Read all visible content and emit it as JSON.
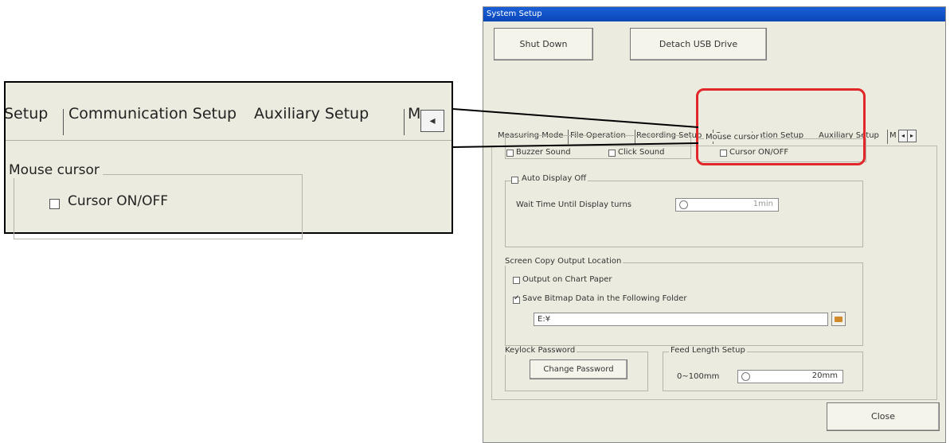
{
  "window": {
    "title": "System Setup"
  },
  "top_buttons": {
    "shutdown": "Shut Down",
    "detach": "Detach USB Drive"
  },
  "tabs": [
    "Measuring Mode",
    "File Operation",
    "Recording Setup",
    "Communication Setup",
    "Auxiliary Setup",
    "M"
  ],
  "tab_arrows": {
    "left": "◂",
    "right": "▸"
  },
  "sound_group": {
    "buzzer": "Buzzer Sound",
    "click": "Click Sound"
  },
  "mouse_cursor_group": {
    "title": "Mouse cursor",
    "checkbox": "Cursor ON/OFF"
  },
  "auto_display_off": {
    "title": "Auto Display Off",
    "wait_label": "Wait Time Until Display turns",
    "wait_value": "1min"
  },
  "screen_copy": {
    "title": "Screen Copy Output Location",
    "output_chart": "Output on Chart Paper",
    "save_bitmap": "Save Bitmap Data in the Following Folder",
    "folder_value": "E:¥"
  },
  "keylock": {
    "title": "Keylock Password",
    "button": "Change Password"
  },
  "feed_length": {
    "title": "Feed Length Setup",
    "range": "0~100mm",
    "value": "20mm"
  },
  "close_button": "Close",
  "zoom": {
    "tab_setup": "Setup",
    "tab_comm": "Communication Setup",
    "tab_aux": "Auxiliary Setup",
    "tab_m": "M",
    "arrow": "◂",
    "group_title": "Mouse cursor",
    "checkbox_label": "Cursor ON/OFF"
  },
  "colors": {
    "title_bar": "#0a47b8",
    "highlight": "#e1272a",
    "panel_bg": "#ecebdf"
  }
}
